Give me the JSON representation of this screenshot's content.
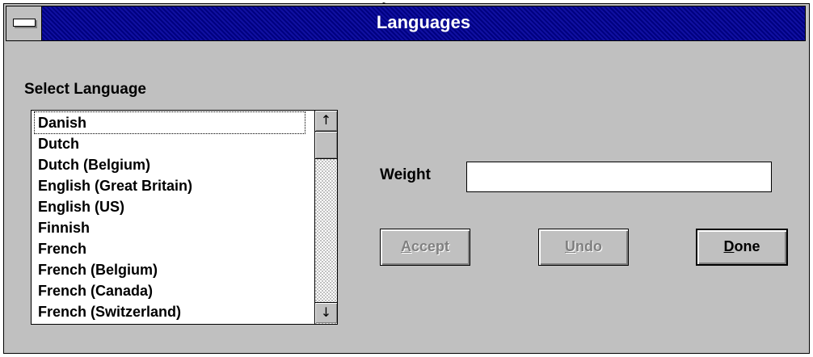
{
  "window": {
    "caption": "Languages",
    "title": "Languages"
  },
  "select_language": {
    "label": "Select Language",
    "items": [
      "Danish",
      "Dutch",
      "Dutch (Belgium)",
      "English (Great Britain)",
      "English (US)",
      "Finnish",
      "French",
      "French (Belgium)",
      "French (Canada)",
      "French (Switzerland)"
    ],
    "selected": "Danish",
    "scroll_up": "↑",
    "scroll_down": "↓"
  },
  "weight": {
    "label": "Weight",
    "value": ""
  },
  "buttons": {
    "accept": {
      "mnemonic": "A",
      "rest": "ccept"
    },
    "undo": {
      "mnemonic": "U",
      "rest": "ndo"
    },
    "done": {
      "mnemonic": "D",
      "rest": "one"
    }
  }
}
